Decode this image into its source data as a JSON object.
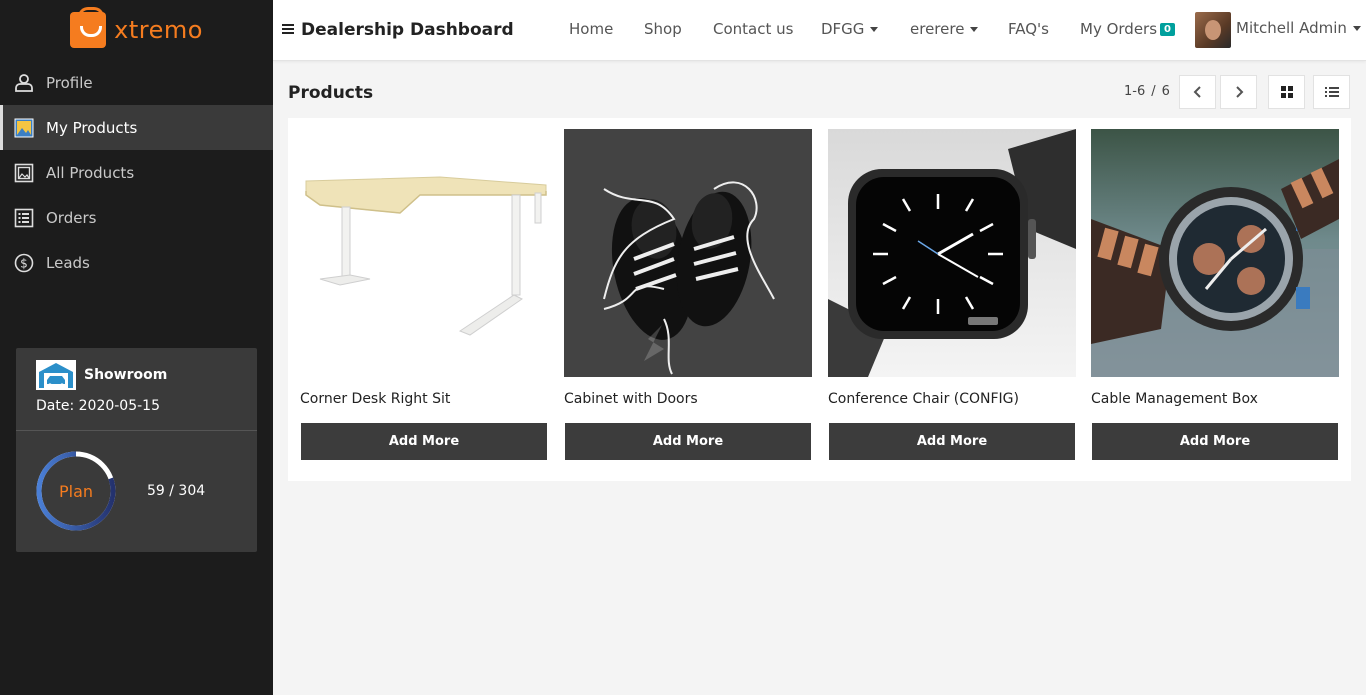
{
  "brand": {
    "name": "xtremo"
  },
  "sidebar": {
    "items": [
      {
        "label": "Profile",
        "icon": "user-icon"
      },
      {
        "label": "My Products",
        "icon": "image-icon"
      },
      {
        "label": "All Products",
        "icon": "gallery-icon"
      },
      {
        "label": "Orders",
        "icon": "list-icon"
      },
      {
        "label": "Leads",
        "icon": "dollar-icon"
      }
    ],
    "showroom": {
      "title": "Showroom",
      "date": "Date: 2020-05-15",
      "plan_label": "Plan",
      "plan_count": "59 / 304",
      "plan_used": 59,
      "plan_total": 304
    }
  },
  "header": {
    "title": "Dealership Dashboard",
    "nav": {
      "home": "Home",
      "shop": "Shop",
      "contact": "Contact us",
      "dfgg": "DFGG",
      "ererere": "ererere",
      "faq": "FAQ's",
      "my_orders": "My Orders",
      "orders_count": "0",
      "user": "Mitchell Admin"
    }
  },
  "main": {
    "title": "Products",
    "pager": {
      "range": "1-6",
      "total": "6"
    },
    "add_label": "Add More",
    "products": [
      {
        "name": "Corner Desk Right Sit"
      },
      {
        "name": "Cabinet with Doors"
      },
      {
        "name": "Conference Chair (CONFIG)"
      },
      {
        "name": "Cable Management Box"
      }
    ]
  },
  "colors": {
    "accent": "#f57c1f",
    "sidebar_bg": "#1c1c1c",
    "badge": "#00a09d",
    "button": "#3c3c3c"
  }
}
